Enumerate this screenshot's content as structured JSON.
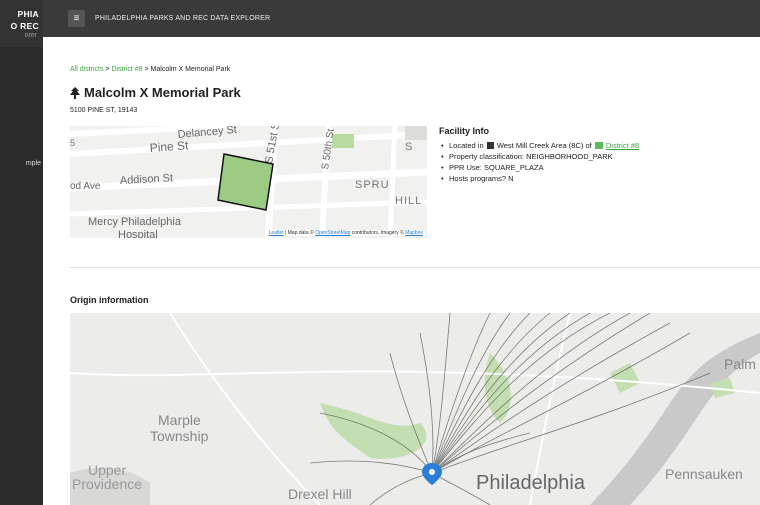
{
  "sidebar": {
    "brand_line1": "PHIA",
    "brand_line2": "O REC",
    "brand_sub": "orer",
    "item": "mple"
  },
  "topbar": {
    "menu_icon": "hamburger-icon",
    "title": "PHILADELPHIA PARKS AND REC DATA EXPLORER"
  },
  "breadcrumb": {
    "all": "All districts",
    "sep1": " > ",
    "district": "District #8",
    "sep2": " > ",
    "current": "Malcolm X Memorial Park"
  },
  "park": {
    "icon": "tree-icon",
    "name": "Malcolm X Memorial Park",
    "address": "5100 PINE ST, 19143"
  },
  "mini_map": {
    "labels": [
      "Delancey St",
      "Pine St",
      "Addison St",
      "od Ave",
      "Mercy Philadelphia",
      "Hospital",
      "S 51st St",
      "S 50th St",
      "SPRU",
      "HILL",
      "S",
      "5"
    ],
    "attribution": {
      "leaflet": "Leaflet",
      "text1": " | Map data © ",
      "osm": "OpenStreetMap",
      "text2": " contributors, Imagery © ",
      "mapbox": "Mapbox"
    }
  },
  "facility": {
    "heading": "Facility Info",
    "located_prefix": "Located in",
    "area": "West Mill Creek Area (8C) of",
    "district_link": "District #8",
    "classification": "Property classification: NEIGHBORHOOD_PARK",
    "ppr_use": "PPR Use: SQUARE_PLAZA",
    "hosts": "Hosts programs? N"
  },
  "origin": {
    "heading": "Origin information",
    "labels": {
      "marple": "Marple",
      "township": "Township",
      "upper": "Upper",
      "providence": "Providence",
      "drexel": "Drexel Hill",
      "philadelphia": "Philadelphia",
      "pennsauken": "Pennsauken",
      "palm": "Palm"
    }
  },
  "colors": {
    "accent_green": "#3fa33f",
    "park_fill": "#9ccc83",
    "marker": "#2a7fd4"
  }
}
